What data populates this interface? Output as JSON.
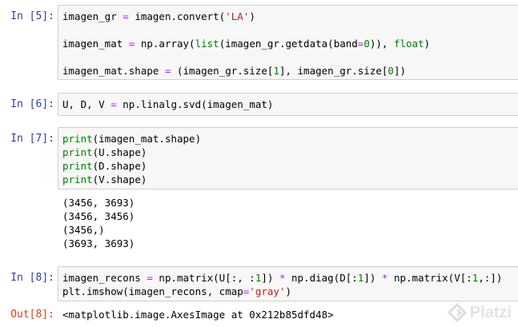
{
  "cells": [
    {
      "prompt": "In [5]:",
      "lines": [
        [
          {
            "t": "imagen_gr "
          },
          {
            "t": "=",
            "c": "o"
          },
          {
            "t": " imagen.convert("
          },
          {
            "t": "'LA'",
            "c": "s"
          },
          {
            "t": ")"
          }
        ],
        [],
        [
          {
            "t": "imagen_mat "
          },
          {
            "t": "=",
            "c": "o"
          },
          {
            "t": " np.array("
          },
          {
            "t": "list",
            "c": "k"
          },
          {
            "t": "(imagen_gr.getdata(band"
          },
          {
            "t": "=",
            "c": "o"
          },
          {
            "t": "0",
            "c": "n"
          },
          {
            "t": ")), "
          },
          {
            "t": "float",
            "c": "k"
          },
          {
            "t": ")"
          }
        ],
        [],
        [
          {
            "t": "imagen_mat.shape "
          },
          {
            "t": "=",
            "c": "o"
          },
          {
            "t": " (imagen_gr.size["
          },
          {
            "t": "1",
            "c": "n"
          },
          {
            "t": "], imagen_gr.size["
          },
          {
            "t": "0",
            "c": "n"
          },
          {
            "t": "])"
          }
        ]
      ]
    },
    {
      "prompt": "In [6]:",
      "lines": [
        [
          {
            "t": "U, D, V "
          },
          {
            "t": "=",
            "c": "o"
          },
          {
            "t": " np.linalg.svd(imagen_mat)"
          }
        ]
      ]
    },
    {
      "prompt": "In [7]:",
      "lines": [
        [
          {
            "t": "print",
            "c": "k"
          },
          {
            "t": "(imagen_mat.shape)"
          }
        ],
        [
          {
            "t": "print",
            "c": "k"
          },
          {
            "t": "(U.shape)"
          }
        ],
        [
          {
            "t": "print",
            "c": "k"
          },
          {
            "t": "(D.shape)"
          }
        ],
        [
          {
            "t": "print",
            "c": "k"
          },
          {
            "t": "(V.shape)"
          }
        ]
      ],
      "output": [
        "(3456, 3693)",
        "(3456, 3456)",
        "(3456,)",
        "(3693, 3693)"
      ]
    },
    {
      "prompt": "In [8]:",
      "lines": [
        [
          {
            "t": "imagen_recons "
          },
          {
            "t": "=",
            "c": "o"
          },
          {
            "t": " np.matrix(U[:, :"
          },
          {
            "t": "1",
            "c": "n"
          },
          {
            "t": "]) "
          },
          {
            "t": "*",
            "c": "o"
          },
          {
            "t": " np.diag(D[:"
          },
          {
            "t": "1",
            "c": "n"
          },
          {
            "t": "]) "
          },
          {
            "t": "*",
            "c": "o"
          },
          {
            "t": " np.matrix(V[:"
          },
          {
            "t": "1",
            "c": "n"
          },
          {
            "t": ",:])"
          }
        ],
        [
          {
            "t": "plt.imshow(imagen_recons, cmap"
          },
          {
            "t": "=",
            "c": "o"
          },
          {
            "t": "'gray'",
            "c": "s"
          },
          {
            "t": ")"
          }
        ]
      ],
      "out_prompt": "Out[8]:",
      "out_text": "<matplotlib.image.AxesImage at 0x212b85dfd48>"
    }
  ],
  "watermark": {
    "text": "Platzi",
    "icon": "platzi-logo-icon"
  }
}
